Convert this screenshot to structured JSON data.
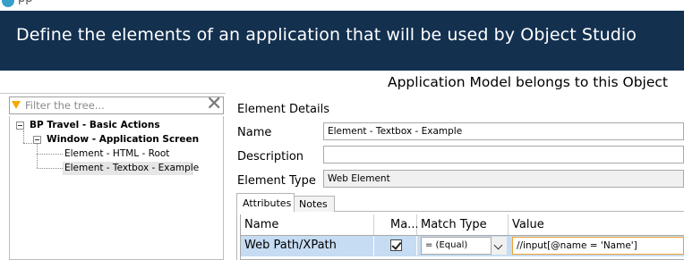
{
  "window": {
    "title_fragment": "pp"
  },
  "header": {
    "title": "Define the elements of an application that will be used by Object Studio",
    "bg_color": "#13304f"
  },
  "subtitle": "Application Model belongs to this Object",
  "filter": {
    "placeholder": "Filter the tree..."
  },
  "tree": {
    "root": "BP Travel - Basic Actions",
    "window_node": "Window - Application Screen",
    "children": [
      "Element - HTML - Root",
      "Element - Textbox - Example"
    ],
    "selected": "Element - Textbox - Example"
  },
  "details": {
    "heading": "Element Details",
    "name_label": "Name",
    "name_value": "Element - Textbox - Example",
    "description_label": "Description",
    "description_value": "",
    "type_label": "Element Type",
    "type_value": "Web Element"
  },
  "tabs": {
    "attributes": "Attributes",
    "notes": "Notes",
    "active": "Attributes"
  },
  "grid": {
    "columns": [
      "Name",
      "Ma...",
      "Match Type",
      "Value"
    ],
    "rows": [
      {
        "name": "Web Path/XPath",
        "match": true,
        "match_type": "=  (Equal)",
        "value": "//input[@name = 'Name']"
      }
    ],
    "selected_row_color": "#c6dcf2"
  },
  "icons": {
    "filter": "funnel-icon",
    "clear": "close-icon",
    "expander": "minus-box-icon",
    "dropdown": "chevron-down-icon",
    "sort": "sort-down-icon"
  }
}
